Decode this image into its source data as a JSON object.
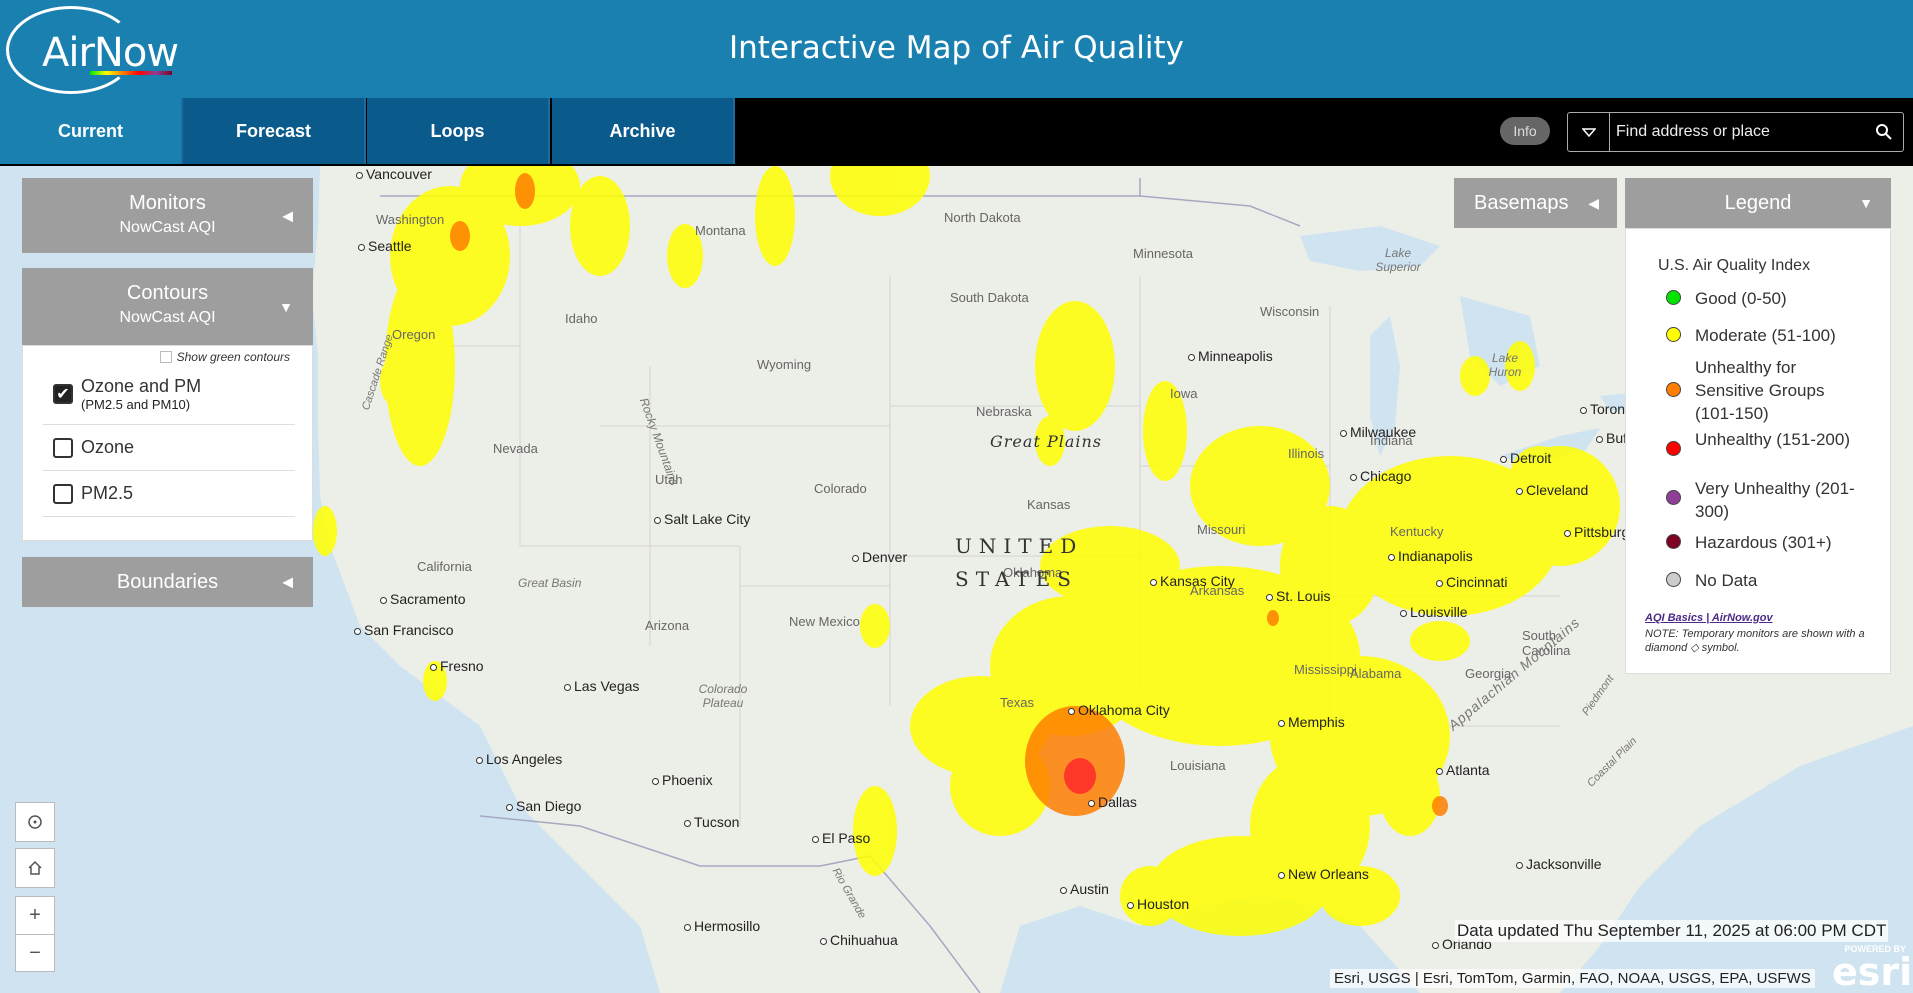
{
  "header": {
    "logo_text": "AirNow",
    "title": "Interactive Map of Air Quality"
  },
  "nav": {
    "tabs": [
      {
        "label": "Current",
        "active": true
      },
      {
        "label": "Forecast",
        "active": false
      },
      {
        "label": "Loops",
        "active": false
      },
      {
        "label": "Archive",
        "active": false
      }
    ],
    "info_label": "Info",
    "search_placeholder": "Find address or place"
  },
  "panels": {
    "monitors": {
      "title": "Monitors",
      "subtitle": "NowCast AQI"
    },
    "contours": {
      "title": "Contours",
      "subtitle": "NowCast AQI",
      "green_toggle": "Show green contours",
      "options": [
        {
          "label": "Ozone and PM",
          "sub": "(PM2.5 and PM10)",
          "checked": true
        },
        {
          "label": "Ozone",
          "sub": "",
          "checked": false
        },
        {
          "label": "PM2.5",
          "sub": "",
          "checked": false
        }
      ]
    },
    "boundaries": {
      "title": "Boundaries"
    }
  },
  "basemaps": {
    "label": "Basemaps"
  },
  "legend": {
    "title": "Legend",
    "subtitle": "U.S. Air Quality Index",
    "items": [
      {
        "label": "Good (0-50)",
        "color": "#00e400"
      },
      {
        "label": "Moderate (51-100)",
        "color": "#ffff00"
      },
      {
        "label": "Unhealthy for Sensitive Groups (101-150)",
        "color": "#ff7e00"
      },
      {
        "label": "Unhealthy (151-200)",
        "color": "#ff0000"
      },
      {
        "label": "Very Unhealthy (201-300)",
        "color": "#8f3f97"
      },
      {
        "label": "Hazardous (301+)",
        "color": "#7e0023"
      },
      {
        "label": "No Data",
        "color": "#cccccc"
      }
    ],
    "link": "AQI Basics | AirNow.gov",
    "note": "NOTE: Temporary monitors are shown with a diamond ◇ symbol."
  },
  "map": {
    "places": [
      "Vancouver",
      "Seattle",
      "Sacramento",
      "San Francisco",
      "Fresno",
      "Las Vegas",
      "Los Angeles",
      "San Diego",
      "Phoenix",
      "Tucson",
      "El Paso",
      "Salt Lake City",
      "Denver",
      "Kansas City",
      "Oklahoma City",
      "Dallas",
      "Austin",
      "Houston",
      "St. Louis",
      "Memphis",
      "Minneapolis",
      "Milwaukee",
      "Chicago",
      "Detroit",
      "Cleveland",
      "Indianapolis",
      "Cincinnati",
      "Louisville",
      "Atlanta",
      "Jacksonville",
      "New Orleans",
      "Pittsburgh",
      "Toron",
      "Buf",
      "Hermosillo",
      "Chihuahua",
      "Orlando"
    ],
    "regions": [
      "Washington",
      "Oregon",
      "Idaho",
      "Montana",
      "Wyoming",
      "Nevada",
      "California",
      "Utah",
      "Colorado",
      "Arizona",
      "New Mexico",
      "North Dakota",
      "South Dakota",
      "Nebraska",
      "Kansas",
      "Oklahoma",
      "Texas",
      "Minnesota",
      "Iowa",
      "Missouri",
      "Arkansas",
      "Wisconsin",
      "Illinois",
      "Indiana",
      "Kentucky",
      "Mississippi",
      "Alabama",
      "Georgia",
      "Louisiana",
      "South Carolina"
    ],
    "features": [
      "Rocky Mountains",
      "Great Basin",
      "Colorado Plateau",
      "Cascade Range",
      "Lake Superior",
      "Lake Huron",
      "Appalachian Mountains",
      "Piedmont",
      "Coastal Plain",
      "Rio Grande"
    ],
    "country": "UNITED STATES",
    "plains": "Great Plains"
  },
  "status": {
    "updated": "Data updated Thu September 11, 2025 at 06:00 PM CDT",
    "attribution": "Esri, USGS | Esri, TomTom, Garmin, FAO, NOAA, USGS, EPA, USFWS",
    "powered_by": "POWERED BY",
    "esri": "esri"
  }
}
